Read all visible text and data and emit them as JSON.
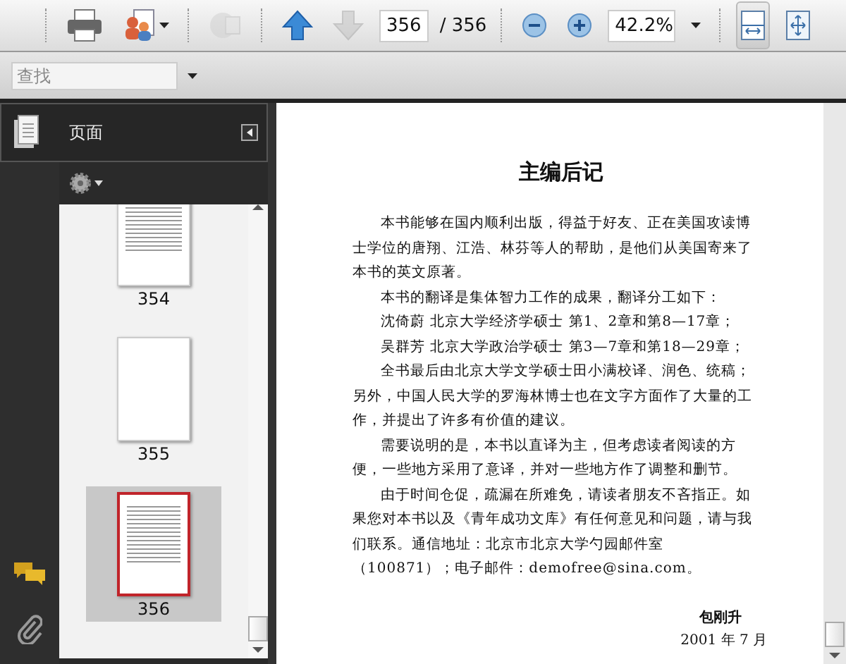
{
  "toolbar": {
    "page_number": "356",
    "page_total": "/ 356",
    "zoom": "42.2%",
    "fit_width_pressed": true,
    "next_page_disabled": true
  },
  "find": {
    "placeholder": "查找"
  },
  "panel": {
    "title": "页面",
    "thumbnails": [
      {
        "label": "354",
        "kind": "text",
        "selected": false
      },
      {
        "label": "355",
        "kind": "blank",
        "selected": false
      },
      {
        "label": "356",
        "kind": "text",
        "selected": true
      }
    ]
  },
  "document": {
    "title": "主编后记",
    "paragraphs": [
      "本书能够在国内顺利出版，得益于好友、正在美国攻读博士学位的唐翔、江浩、林芬等人的帮助，是他们从美国寄来了本书的英文原著。",
      "本书的翻译是集体智力工作的成果，翻译分工如下：",
      "沈倚蔚 北京大学经济学硕士 第1、2章和第8—17章；",
      "吴群芳 北京大学政治学硕士 第3—7章和第18—29章；",
      "全书最后由北京大学文学硕士田小满校译、润色、统稿；另外，中国人民大学的罗海林博士也在文字方面作了大量的工作，并提出了许多有价值的建议。",
      "需要说明的是，本书以直译为主，但考虑读者阅读的方便，一些地方采用了意译，并对一些地方作了调整和删节。",
      "由于时间仓促，疏漏在所难免，请读者朋友不吝指正。如果您对本书以及《青年成功文库》有任何意见和问题，请与我们联系。通信地址：北京市北京大学勺园邮件室（100871）；电子邮件：demofree@sina.com。"
    ],
    "signature": "包刚升",
    "date": "2001 年 7 月"
  }
}
